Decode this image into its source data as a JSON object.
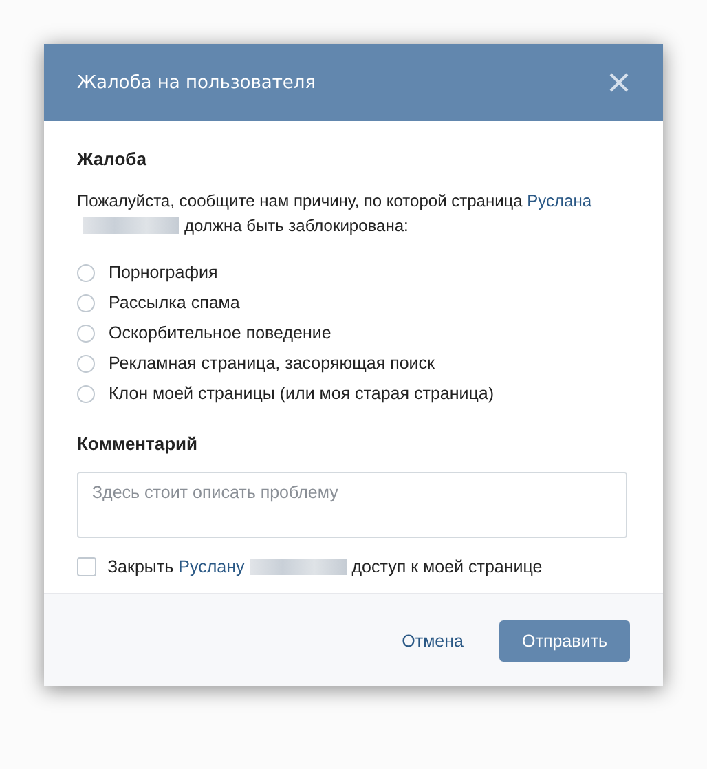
{
  "dialog": {
    "title": "Жалоба на пользователя"
  },
  "complaint": {
    "heading": "Жалоба",
    "prompt_before": "Пожалуйста, сообщите нам причину, по которой страница",
    "user_link": "Руслана",
    "prompt_after": "должна быть заблокирована:"
  },
  "reasons": [
    {
      "label": "Порнография",
      "selected": false
    },
    {
      "label": "Рассылка спама",
      "selected": false
    },
    {
      "label": "Оскорбительное поведение",
      "selected": false
    },
    {
      "label": "Рекламная страница, засоряющая поиск",
      "selected": false
    },
    {
      "label": "Клон моей страницы (или моя старая страница)",
      "selected": false
    }
  ],
  "comment": {
    "heading": "Комментарий",
    "placeholder": "Здесь стоит описать проблему"
  },
  "block_option": {
    "before": "Закрыть",
    "user_link": "Руслану",
    "after": "доступ к моей странице",
    "checked": false
  },
  "buttons": {
    "cancel": "Отмена",
    "submit": "Отправить"
  }
}
